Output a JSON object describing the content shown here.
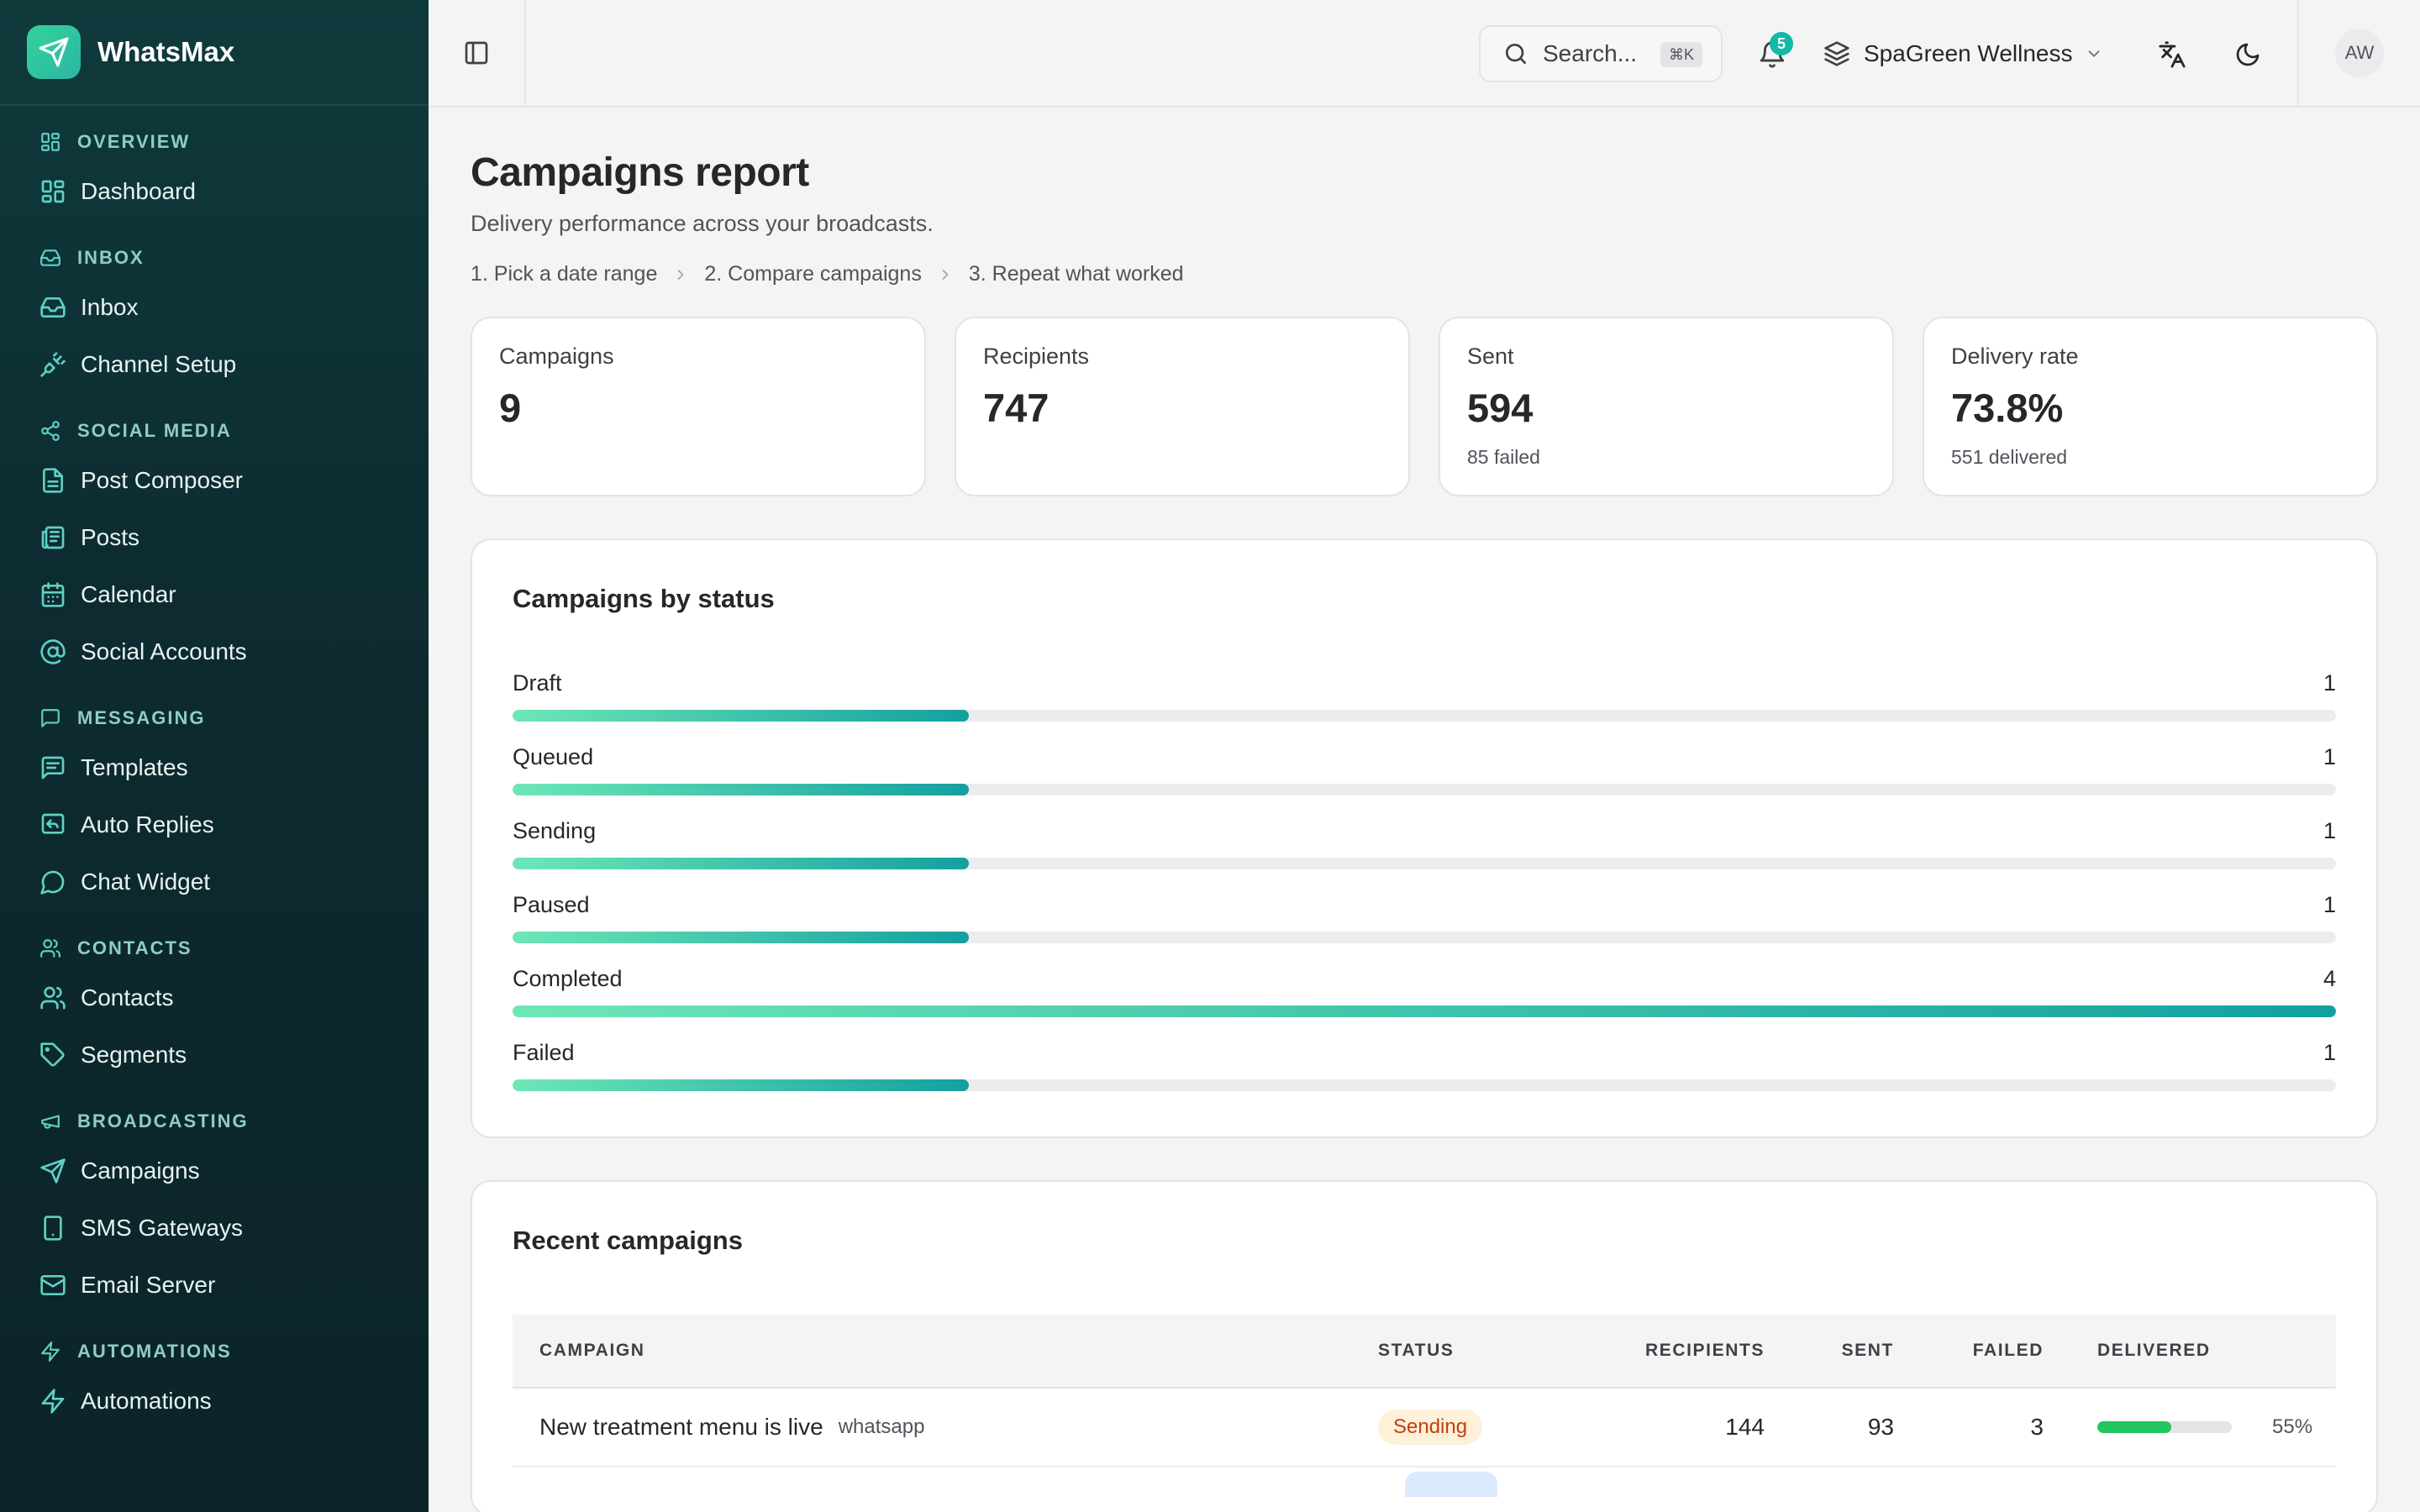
{
  "brand": {
    "name": "WhatsMax"
  },
  "sidebar": {
    "sections": [
      {
        "label": "OVERVIEW",
        "icon": "dashboard-icon",
        "items": [
          {
            "label": "Dashboard",
            "icon": "dashboard-icon"
          }
        ]
      },
      {
        "label": "INBOX",
        "icon": "inbox-icon",
        "items": [
          {
            "label": "Inbox",
            "icon": "inbox-icon"
          },
          {
            "label": "Channel Setup",
            "icon": "plug-icon"
          }
        ]
      },
      {
        "label": "SOCIAL MEDIA",
        "icon": "share-icon",
        "items": [
          {
            "label": "Post Composer",
            "icon": "file-icon"
          },
          {
            "label": "Posts",
            "icon": "newspaper-icon"
          },
          {
            "label": "Calendar",
            "icon": "calendar-icon"
          },
          {
            "label": "Social Accounts",
            "icon": "at-sign-icon"
          }
        ]
      },
      {
        "label": "MESSAGING",
        "icon": "message-icon",
        "items": [
          {
            "label": "Templates",
            "icon": "message-text-icon"
          },
          {
            "label": "Auto Replies",
            "icon": "reply-icon"
          },
          {
            "label": "Chat Widget",
            "icon": "chat-bubble-icon"
          }
        ]
      },
      {
        "label": "CONTACTS",
        "icon": "users-icon",
        "items": [
          {
            "label": "Contacts",
            "icon": "users-icon"
          },
          {
            "label": "Segments",
            "icon": "tag-icon"
          }
        ]
      },
      {
        "label": "BROADCASTING",
        "icon": "megaphone-icon",
        "items": [
          {
            "label": "Campaigns",
            "icon": "send-icon"
          },
          {
            "label": "SMS Gateways",
            "icon": "phone-icon"
          },
          {
            "label": "Email Server",
            "icon": "mail-icon"
          }
        ]
      },
      {
        "label": "AUTOMATIONS",
        "icon": "zap-icon",
        "items": [
          {
            "label": "Automations",
            "icon": "zap-icon"
          }
        ]
      }
    ]
  },
  "header": {
    "search_placeholder": "Search...",
    "search_shortcut": "⌘K",
    "notification_count": "5",
    "workspace": "SpaGreen Wellness",
    "avatar_initials": "AW"
  },
  "page": {
    "title": "Campaigns report",
    "subtitle": "Delivery performance across your broadcasts.",
    "steps": [
      "1.  Pick a date range",
      "2.  Compare campaigns",
      "3.  Repeat what worked"
    ]
  },
  "stats": [
    {
      "label": "Campaigns",
      "value": "9",
      "sub": ""
    },
    {
      "label": "Recipients",
      "value": "747",
      "sub": ""
    },
    {
      "label": "Sent",
      "value": "594",
      "sub": "85 failed"
    },
    {
      "label": "Delivery rate",
      "value": "73.8%",
      "sub": "551 delivered"
    }
  ],
  "status_card": {
    "title": "Campaigns by status",
    "max": 4,
    "rows": [
      {
        "label": "Draft",
        "count": 1
      },
      {
        "label": "Queued",
        "count": 1
      },
      {
        "label": "Sending",
        "count": 1
      },
      {
        "label": "Paused",
        "count": 1
      },
      {
        "label": "Completed",
        "count": 4
      },
      {
        "label": "Failed",
        "count": 1
      }
    ]
  },
  "recent": {
    "title": "Recent campaigns",
    "columns": [
      "CAMPAIGN",
      "STATUS",
      "RECIPIENTS",
      "SENT",
      "FAILED",
      "DELIVERED"
    ],
    "rows": [
      {
        "name": "New treatment menu is live",
        "channel": "whatsapp",
        "status": "Sending",
        "recipients": "144",
        "sent": "93",
        "failed": "3",
        "delivered_pct": 55,
        "delivered_label": "55%"
      }
    ]
  },
  "colors": {
    "accent": "#14b8a6",
    "sidebar_bg": "#0d2b30",
    "bar_start": "#6ee7b7",
    "bar_end": "#14a0a0",
    "delivered_bar": "#22c55e"
  }
}
